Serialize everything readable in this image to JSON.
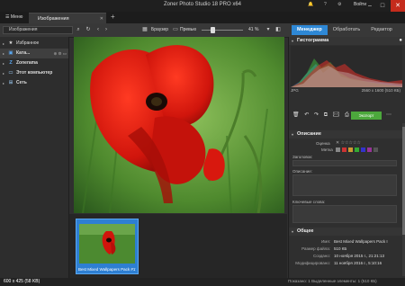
{
  "window": {
    "title": "Zoner Photo Studio 18 PRO x64",
    "user_label": "Войти"
  },
  "tabs": {
    "menu_label": "Меню",
    "active_label": "Изображения",
    "add_symbol": "+"
  },
  "toolbar": {
    "path_label": "Изображения",
    "browser_label": "Браузер",
    "preview_label": "Превью",
    "zoom_value": "41 %",
    "zoom_fraction": 0.28,
    "modes": [
      "Менеджер",
      "Обработать",
      "Редактор"
    ]
  },
  "nav": {
    "items": [
      {
        "label": "Избранное",
        "icon": "star-icon",
        "glyph": "★"
      },
      {
        "label": "Ката...",
        "icon": "catalog-icon",
        "glyph": "▣"
      },
      {
        "label": "Zonerama",
        "icon": "zonerama-icon",
        "glyph": "Z"
      },
      {
        "label": "Этот компьютер",
        "icon": "computer-icon",
        "glyph": "▭"
      },
      {
        "label": "Сеть",
        "icon": "network-icon",
        "glyph": "⊞"
      }
    ]
  },
  "filmstrip": {
    "thumb_label": "Best Mixed Wallpapers Pack #17..."
  },
  "right_panel": {
    "histogram_title": "Гистограмма",
    "histogram_left": "JPG",
    "histogram_right": "2560 x 1600 (510 КБ)",
    "export_label": "Экспорт",
    "description_title": "Описание",
    "rating_label": "Оценка",
    "marks_label": "Метка",
    "title_label": "Заголовок:",
    "desc_label": "Описание:",
    "keywords_label": "Ключевые слова:",
    "general_title": "Общее",
    "info": [
      {
        "key": "Имя:",
        "value": "Best Mixed Wallpapers Pack I"
      },
      {
        "key": "Размер файла:",
        "value": "510 КБ"
      },
      {
        "key": "Создано:",
        "value": "10 ноября 2015 г., 21:21:13"
      },
      {
        "key": "Модифицировано:",
        "value": "11 ноября 2016 г., 5:10:16"
      }
    ]
  },
  "status": {
    "left": "600 x 425 (58 KB)",
    "right": "Показано: 1    Выделенные элементы: 1 (510 КБ)"
  },
  "colors": {
    "accent": "#2e88d6",
    "export": "#4ca83c",
    "close": "#c42b1c",
    "poppy": "#d01a10"
  }
}
